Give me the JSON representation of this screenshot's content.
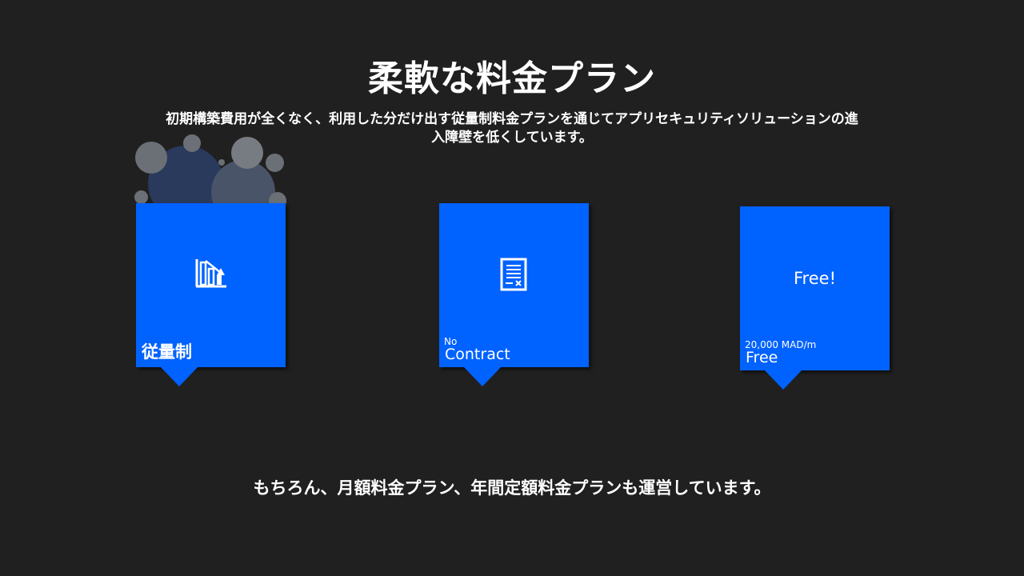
{
  "slide": {
    "title": "柔軟な料金プラン",
    "subtitle": "初期構築費用が全くなく、利用した分だけ出す従量制料金プランを通じてアプリセキュリティソリューションの進入障壁を低くしています。",
    "footer": "もちろん、月額料金プラン、年間定額料金プランも運営しています。"
  },
  "cards": [
    {
      "icon": "chart-decrease-icon",
      "label": "従量制",
      "small": ""
    },
    {
      "icon": "contract-document-icon",
      "label": "Contract",
      "small": "No"
    },
    {
      "big_text": "Free!",
      "label": "Free",
      "small": "20,000 MAD/m"
    }
  ],
  "colors": {
    "background": "#202020",
    "card": "#0062ff",
    "text": "#ffffff"
  }
}
